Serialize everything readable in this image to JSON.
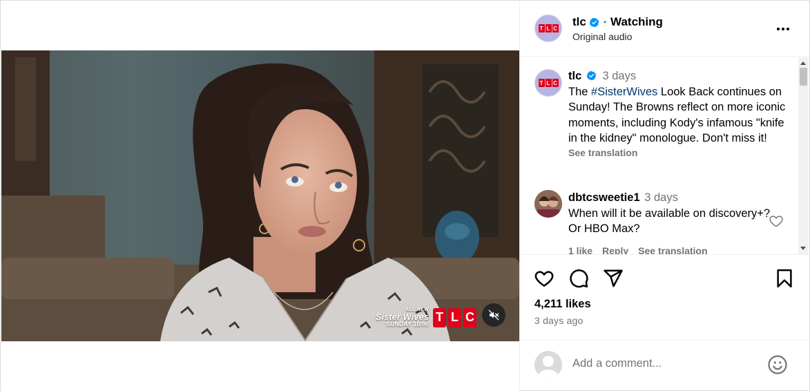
{
  "post": {
    "username": "tlc",
    "verified": true,
    "status": "Watching",
    "audio": "Original audio",
    "logo_letters": [
      "T",
      "L",
      "C"
    ]
  },
  "video": {
    "promo_allnew": "ALL NEW",
    "promo_show": "Sister Wives",
    "promo_when": "SUNDAY 10/9c",
    "channel_letters": [
      "T",
      "L",
      "C"
    ],
    "muted": true
  },
  "caption": {
    "username": "tlc",
    "time": "3 days",
    "text_before": "The ",
    "hashtag": "#SisterWives",
    "text_after": " Look Back continues on Sunday! The Browns reflect on more iconic moments, including Kody's infamous \"knife in the kidney\" monologue. Don't miss it!",
    "see_translation": "See translation"
  },
  "comment": {
    "username": "dbtcsweetie1",
    "time": "3 days",
    "text": "When will it be available on discovery+? Or HBO Max?",
    "likes": "1 like",
    "reply": "Reply",
    "see_translation": "See translation"
  },
  "engagement": {
    "likes": "4,211 likes",
    "posted": "3 days ago"
  },
  "composer": {
    "placeholder": "Add a comment..."
  },
  "colors": {
    "brand_red": "#e2001a",
    "verified_blue": "#0095f6",
    "hashtag": "#00376b",
    "secondary_text": "#737373"
  },
  "icons": [
    "more-icon",
    "verified-icon",
    "heart-icon",
    "comment-icon",
    "share-icon",
    "save-icon",
    "emoji-icon",
    "mute-icon"
  ]
}
